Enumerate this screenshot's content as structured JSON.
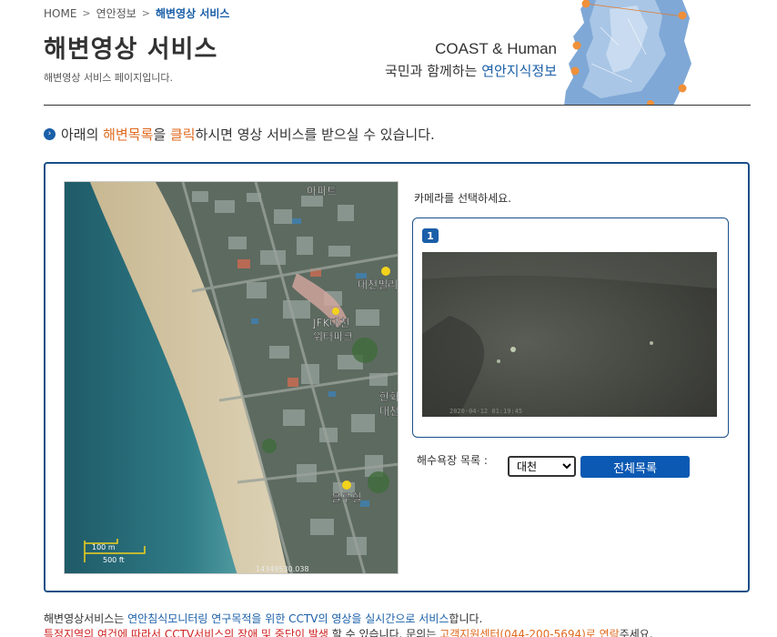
{
  "breadcrumb": {
    "home": "HOME",
    "sep": ">",
    "level1": "연안정보",
    "current": "해변영상 서비스"
  },
  "header": {
    "title": "해변영상 서비스",
    "description": "해변영상 서비스 페이지입니다.",
    "brand_en": "COAST & Human",
    "brand_ko_prefix": "국민과 함께하는 ",
    "brand_ko_highlight": "연안지식정보"
  },
  "notice": {
    "bullet": "›",
    "part1": "아래의 ",
    "hl1": "해변목록",
    "part2": "을 ",
    "hl2": "클릭",
    "part3": "하시면 영상 서비스를 받으실 수 있습니다."
  },
  "map": {
    "labels": {
      "apt": "아파트",
      "daecheon_pil": "대천필리",
      "jfk_line1": "JFK대천",
      "jfk_line2": "워터파크",
      "hanwha_line1": "한화",
      "hanwha_line2": "대천",
      "blue_hill": "블루힐"
    },
    "scale_m": "100 m",
    "scale_ft": "500 ft",
    "coords": "14349530.038"
  },
  "camera": {
    "select_prompt": "카메라를 선택하세요.",
    "badge": "1",
    "timestamp": "2020-04-12 01:19:45"
  },
  "beach": {
    "label": "해수욕장 목록 :",
    "selected": "대천",
    "full_list_button": "전체목록"
  },
  "footer": {
    "line1_a": "해변영상서비스는 ",
    "line1_b": "연안침식모니터링 연구목적을 위한 CCTV의 영상을 실시간으로 서비스",
    "line1_c": "합니다.",
    "line2_a": "특정지역의 여건에 따라서 CCTV서비스의 장애 및 중단이 발생",
    "line2_b": " 할 수 있습니다. 문의는 ",
    "line2_c": "고객지원센터(044-200-5694)로 연락",
    "line2_d": "주세요."
  },
  "colors": {
    "accent": "#1a5fa8",
    "highlight": "#e06a1e",
    "warning": "#d02020",
    "button": "#0b59b3",
    "panel_border": "#1a4f87"
  }
}
